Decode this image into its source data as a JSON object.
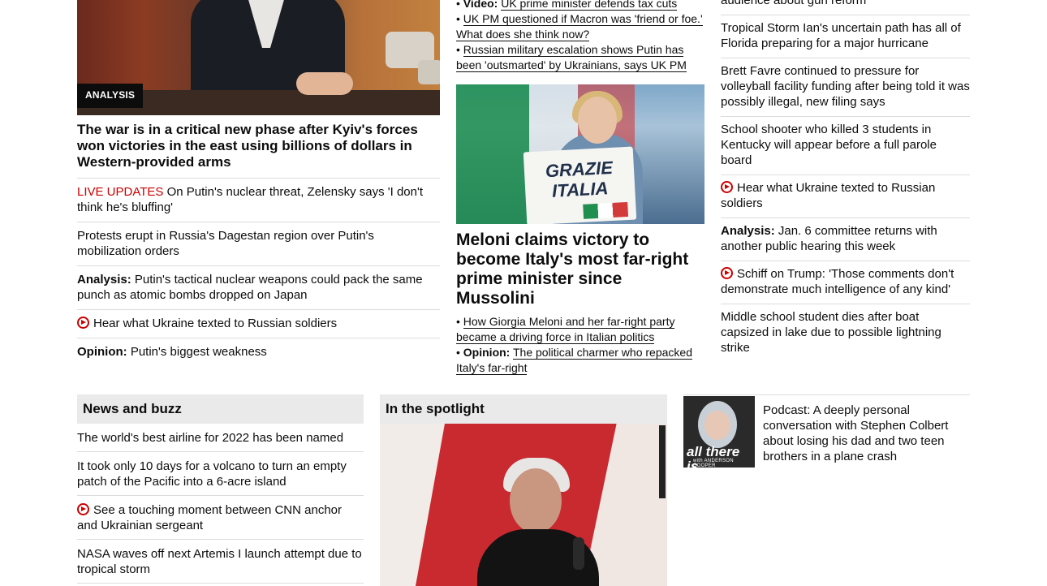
{
  "left": {
    "hero_badge": "ANALYSIS",
    "hero_headline": "The war is in a critical new phase after Kyiv's forces won victories in the east using billions of dollars in Western-provided arms",
    "items": [
      {
        "prefix": "LIVE UPDATES",
        "text": " On Putin's nuclear threat, Zelensky says 'I don't think he's bluffing'"
      },
      {
        "text": "Protests erupt in Russia's Dagestan region over Putin's mobilization orders"
      },
      {
        "prefix": "Analysis:",
        "text": " Putin's tactical nuclear weapons could pack the same punch as atomic bombs dropped on Japan"
      },
      {
        "text": "Hear what Ukraine texted to Russian soldiers",
        "icon": "play-icon"
      },
      {
        "prefix": "Opinion:",
        "text": " Putin's biggest weakness"
      }
    ]
  },
  "middle": {
    "top_bullets": [
      {
        "prefix": "Video:",
        "text": "UK prime minister defends tax cuts"
      },
      {
        "text": "UK PM questioned if Macron was 'friend or foe.' What does she think now?"
      },
      {
        "text": "Russian military escalation shows Putin has been 'outsmarted' by Ukrainians, says UK PM"
      }
    ],
    "sign_line1": "GRAZIE",
    "sign_line2": "ITALIA",
    "headline": "Meloni claims victory to become Italy's most far-right prime minister since Mussolini",
    "bullets": [
      {
        "text": "How Giorgia Meloni and her far-right party became a driving force in Italian politics"
      },
      {
        "prefix": "Opinion:",
        "text": "The political charmer who repacked Italy's far-right"
      }
    ]
  },
  "right": {
    "partial_top": "audience about gun reform",
    "items": [
      {
        "text": "Tropical Storm Ian's uncertain path has all of Florida preparing for a major hurricane"
      },
      {
        "text": "Brett Favre continued to pressure for volleyball facility funding after being told it was possibly illegal, new filing says"
      },
      {
        "text": "School shooter who killed 3 students in Kentucky will appear before a full parole board"
      },
      {
        "text": "Hear what Ukraine texted to Russian soldiers",
        "icon": "play-icon"
      },
      {
        "prefix": "Analysis:",
        "text": " Jan. 6 committee returns with another public hearing this week"
      },
      {
        "text": "Schiff on Trump: 'Those comments don't demonstrate much intelligence of any kind'",
        "icon": "play-icon"
      },
      {
        "text": "Middle school student dies after boat capsized in lake due to possible lightning strike"
      }
    ]
  },
  "news_buzz": {
    "title": "News and buzz",
    "items": [
      {
        "text": "The world's best airline for 2022 has been named"
      },
      {
        "text": "It took only 10 days for a volcano to turn an empty patch of the Pacific into a 6-acre island"
      },
      {
        "text": "See a touching moment between CNN anchor and Ukrainian sergeant",
        "icon": "play-icon"
      },
      {
        "text": "NASA waves off next Artemis I launch attempt due to tropical storm"
      }
    ]
  },
  "spotlight": {
    "title": "In the spotlight"
  },
  "podcast": {
    "thumb_title": "all there is",
    "thumb_sub": "with ANDERSON COOPER",
    "text": "Podcast: A deeply personal conversation with Stephen Colbert about losing his dad and two teen brothers in a plane crash"
  },
  "colors": {
    "live_red": "#cc0000",
    "divider": "#dcdcdc",
    "zone_header_bg": "#eaeaea"
  }
}
